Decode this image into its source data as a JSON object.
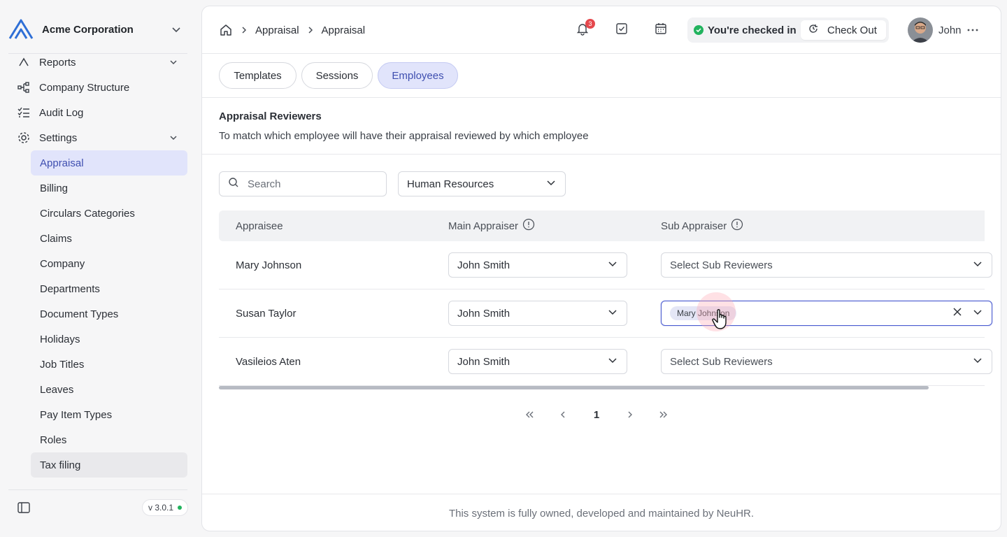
{
  "org": {
    "name": "Acme Corporation"
  },
  "sidebar": {
    "items": [
      {
        "label": "Reports"
      },
      {
        "label": "Company Structure"
      },
      {
        "label": "Audit Log"
      },
      {
        "label": "Settings"
      }
    ],
    "settings_sub": [
      "Appraisal",
      "Billing",
      "Circulars Categories",
      "Claims",
      "Company",
      "Departments",
      "Document Types",
      "Holidays",
      "Job Titles",
      "Leaves",
      "Pay Item Types",
      "Roles",
      "Tax filing"
    ],
    "version": "v 3.0.1"
  },
  "breadcrumb": [
    "Appraisal",
    "Appraisal"
  ],
  "notifications": {
    "count": "3"
  },
  "checkin": {
    "status": "You're checked in",
    "button": "Check Out"
  },
  "user": {
    "name": "John"
  },
  "tabs": [
    "Templates",
    "Sessions",
    "Employees"
  ],
  "section": {
    "title": "Appraisal Reviewers",
    "subtitle": "To match which employee will have their appraisal reviewed by which employee"
  },
  "filters": {
    "search_placeholder": "Search",
    "department": "Human Resources"
  },
  "table": {
    "headers": {
      "appraisee": "Appraisee",
      "main": "Main Appraiser",
      "sub": "Sub Appraiser"
    },
    "rows": [
      {
        "appraisee": "Mary Johnson",
        "main": "John Smith",
        "sub_placeholder": "Select Sub Reviewers"
      },
      {
        "appraisee": "Susan Taylor",
        "main": "John Smith",
        "sub_chip": "Mary Johnson"
      },
      {
        "appraisee": "Vasileios Aten",
        "main": "John Smith",
        "sub_placeholder": "Select Sub Reviewers"
      }
    ]
  },
  "pagination": {
    "current": "1"
  },
  "footer": "This system is fully owned, developed and maintained by NeuHR.",
  "colors": {
    "accent": "#4a5bd0",
    "active_bg": "#e1e4fb",
    "success": "#22b35e",
    "badge": "#e5484d"
  }
}
